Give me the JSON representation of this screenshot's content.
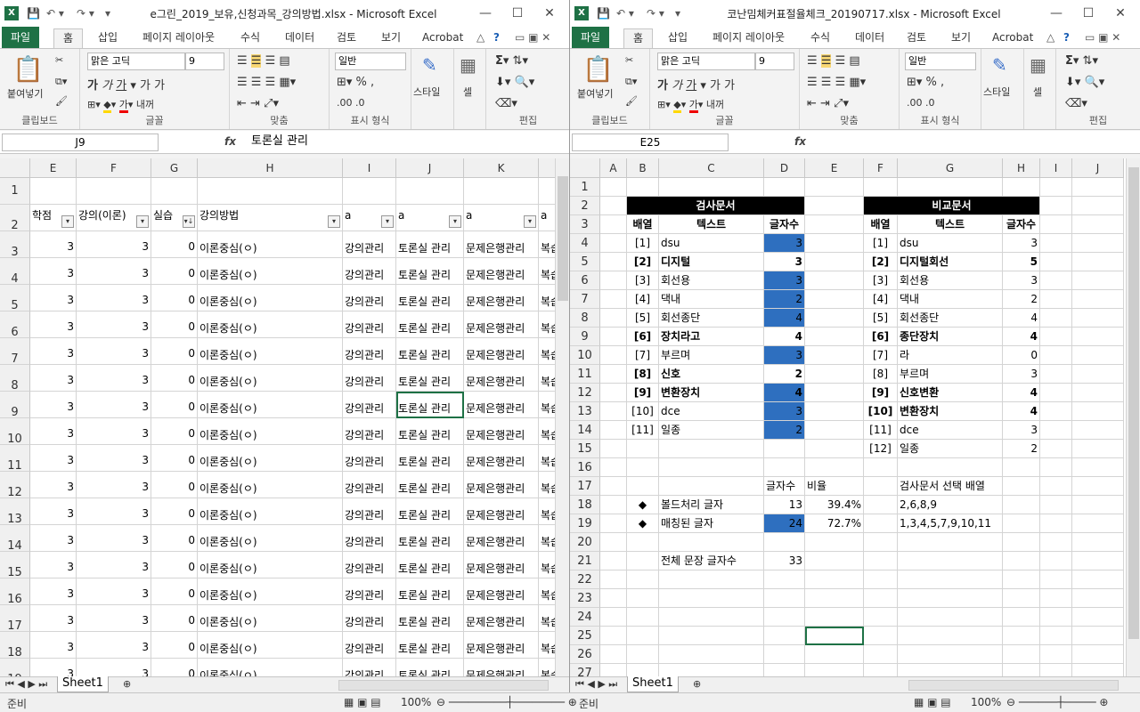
{
  "ribbon_tabs": [
    "파일",
    "홈",
    "삽입",
    "페이지 레이아웃",
    "수식",
    "데이터",
    "검토",
    "보기",
    "Acrobat"
  ],
  "ribbon": {
    "paste": "붙여넣기",
    "font_name": "맑은 고딕",
    "font_size": "9",
    "number_format": "일반",
    "style": "스타일",
    "cell": "셀",
    "groups": [
      "클립보드",
      "글꼴",
      "맞춤",
      "표시 형식",
      "편집"
    ],
    "wrap": "내꺼"
  },
  "left": {
    "title": "e그린_2019_보유,신청과목_강의방법.xlsx  -  Microsoft Excel",
    "namebox": "J9",
    "formula": "토론실 관리",
    "cols": [
      "E",
      "F",
      "G",
      "H",
      "I",
      "J",
      "K",
      ""
    ],
    "header_row": [
      "학점",
      "강의(이론)",
      "실습",
      "강의방법",
      "a",
      "a",
      "a",
      "a"
    ],
    "row_numbers": [
      "1",
      "2",
      "3",
      "4",
      "5",
      "6",
      "7",
      "8",
      "9",
      "10",
      "11",
      "12",
      "13",
      "14",
      "15",
      "16",
      "17",
      "18",
      "19"
    ],
    "row_values": [
      "3",
      "3",
      "0",
      "이론중심(ㅇ)",
      "강의관리",
      "토론실 관리",
      "문제은행관리",
      "복습"
    ],
    "sheet": "Sheet1"
  },
  "right": {
    "title": "코난밈체커표절율체크_20190717.xlsx  -  Microsoft Excel",
    "namebox": "E25",
    "formula": "",
    "cols": [
      "A",
      "B",
      "C",
      "D",
      "E",
      "F",
      "G",
      "H",
      "I",
      "J"
    ],
    "row_numbers": [
      "1",
      "2",
      "3",
      "4",
      "5",
      "6",
      "7",
      "8",
      "9",
      "10",
      "11",
      "12",
      "13",
      "14",
      "15",
      "16",
      "17",
      "18",
      "19",
      "20",
      "21",
      "22",
      "23",
      "24",
      "25",
      "26",
      "27"
    ],
    "check_title": "검사문서",
    "compare_title": "비교문서",
    "col_array": "배열",
    "col_text": "텍스트",
    "col_count": "글자수",
    "check_rows": [
      {
        "idx": "[1]",
        "text": "dsu",
        "count": "3",
        "bold": false,
        "blue": true
      },
      {
        "idx": "[2]",
        "text": "디지털",
        "count": "3",
        "bold": true,
        "blue": false
      },
      {
        "idx": "[3]",
        "text": "회선용",
        "count": "3",
        "bold": false,
        "blue": true
      },
      {
        "idx": "[4]",
        "text": "댁내",
        "count": "2",
        "bold": false,
        "blue": true
      },
      {
        "idx": "[5]",
        "text": "회선종단",
        "count": "4",
        "bold": false,
        "blue": true
      },
      {
        "idx": "[6]",
        "text": "장치라고",
        "count": "4",
        "bold": true,
        "blue": false
      },
      {
        "idx": "[7]",
        "text": "부르며",
        "count": "3",
        "bold": false,
        "blue": true
      },
      {
        "idx": "[8]",
        "text": "신호",
        "count": "2",
        "bold": true,
        "blue": false
      },
      {
        "idx": "[9]",
        "text": "변환장치",
        "count": "4",
        "bold": true,
        "blue": true
      },
      {
        "idx": "[10]",
        "text": "dce",
        "count": "3",
        "bold": false,
        "blue": true
      },
      {
        "idx": "[11]",
        "text": "일종",
        "count": "2",
        "bold": false,
        "blue": true
      }
    ],
    "compare_rows": [
      {
        "idx": "[1]",
        "text": "dsu",
        "count": "3",
        "bold": false
      },
      {
        "idx": "[2]",
        "text": "디지털회선",
        "count": "5",
        "bold": true
      },
      {
        "idx": "[3]",
        "text": "회선용",
        "count": "3",
        "bold": false
      },
      {
        "idx": "[4]",
        "text": "댁내",
        "count": "2",
        "bold": false
      },
      {
        "idx": "[5]",
        "text": "회선종단",
        "count": "4",
        "bold": false
      },
      {
        "idx": "[6]",
        "text": "종단장치",
        "count": "4",
        "bold": true
      },
      {
        "idx": "[7]",
        "text": "라",
        "count": "0",
        "bold": false
      },
      {
        "idx": "[8]",
        "text": "부르며",
        "count": "3",
        "bold": false
      },
      {
        "idx": "[9]",
        "text": "신호변환",
        "count": "4",
        "bold": true
      },
      {
        "idx": "[10]",
        "text": "변환장치",
        "count": "4",
        "bold": true
      },
      {
        "idx": "[11]",
        "text": "dce",
        "count": "3",
        "bold": false
      },
      {
        "idx": "[12]",
        "text": "일종",
        "count": "2",
        "bold": false
      }
    ],
    "summary": {
      "hdr_count": "글자수",
      "hdr_ratio": "비율",
      "hdr_selected": "검사문서 선택 배열",
      "bullet": "◆",
      "bold_label": "볼드처리 글자",
      "bold_count": "13",
      "bold_ratio": "39.4%",
      "bold_array": "2,6,8,9",
      "match_label": "매칭된 글자",
      "match_count": "24",
      "match_ratio": "72.7%",
      "match_array": "1,3,4,5,7,9,10,11",
      "total_label": "전체 문장 글자수",
      "total_count": "33"
    },
    "sheet": "Sheet1"
  },
  "status": {
    "ready": "준비",
    "zoom": "100%"
  }
}
